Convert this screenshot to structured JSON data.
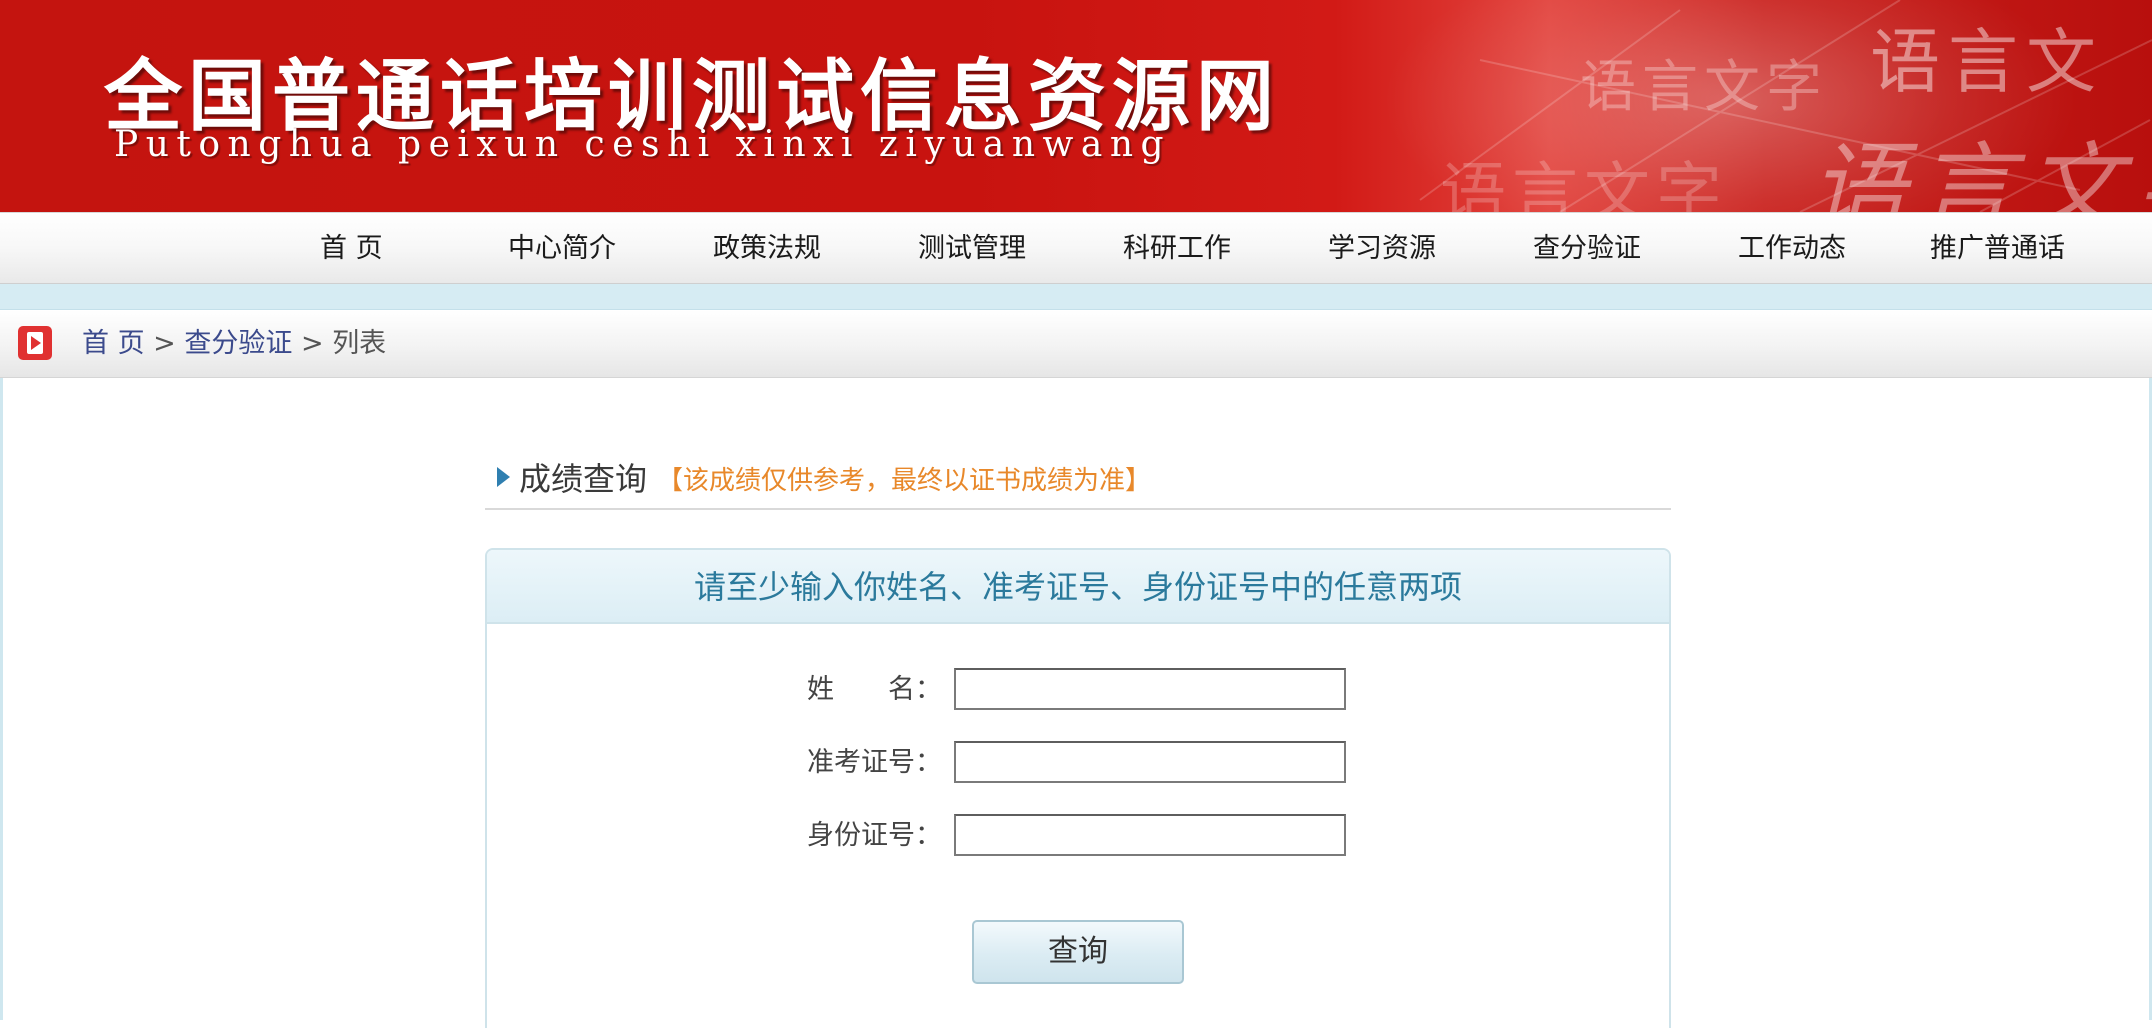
{
  "banner": {
    "title_cn": "全国普通话培训测试信息资源网",
    "title_en": "Putonghua peixun ceshi xinxi ziyuanwang",
    "decor": [
      "语言文字",
      "语言文",
      "语言文字",
      "语言文字"
    ]
  },
  "nav": {
    "items": [
      {
        "label": "首  页"
      },
      {
        "label": "中心简介"
      },
      {
        "label": "政策法规"
      },
      {
        "label": "测试管理"
      },
      {
        "label": "科研工作"
      },
      {
        "label": "学习资源"
      },
      {
        "label": "查分验证"
      },
      {
        "label": "工作动态"
      },
      {
        "label": "推广普通话"
      }
    ]
  },
  "breadcrumb": {
    "home": "首  页",
    "sep1": " > ",
    "section": "查分验证",
    "sep2": " > ",
    "current": "列表"
  },
  "section": {
    "title": "成绩查询",
    "note": "【该成绩仅供参考，最终以证书成绩为准】"
  },
  "form": {
    "instruction": "请至少输入你姓名、准考证号、身份证号中的任意两项",
    "fields": [
      {
        "label": "姓　　名：",
        "value": "",
        "placeholder": ""
      },
      {
        "label": "准考证号：",
        "value": "",
        "placeholder": ""
      },
      {
        "label": "身份证号：",
        "value": "",
        "placeholder": ""
      }
    ],
    "submit_label": "查询"
  },
  "colors": {
    "banner_red": "#c4140f",
    "note_orange": "#e8882a",
    "instruction_blue": "#2b7a9c",
    "breadcrumb_link": "#3b4a8c",
    "strip_blue": "#d6ecf3"
  },
  "icons": {
    "breadcrumb": "play-icon",
    "section": "triangle-right-icon"
  }
}
